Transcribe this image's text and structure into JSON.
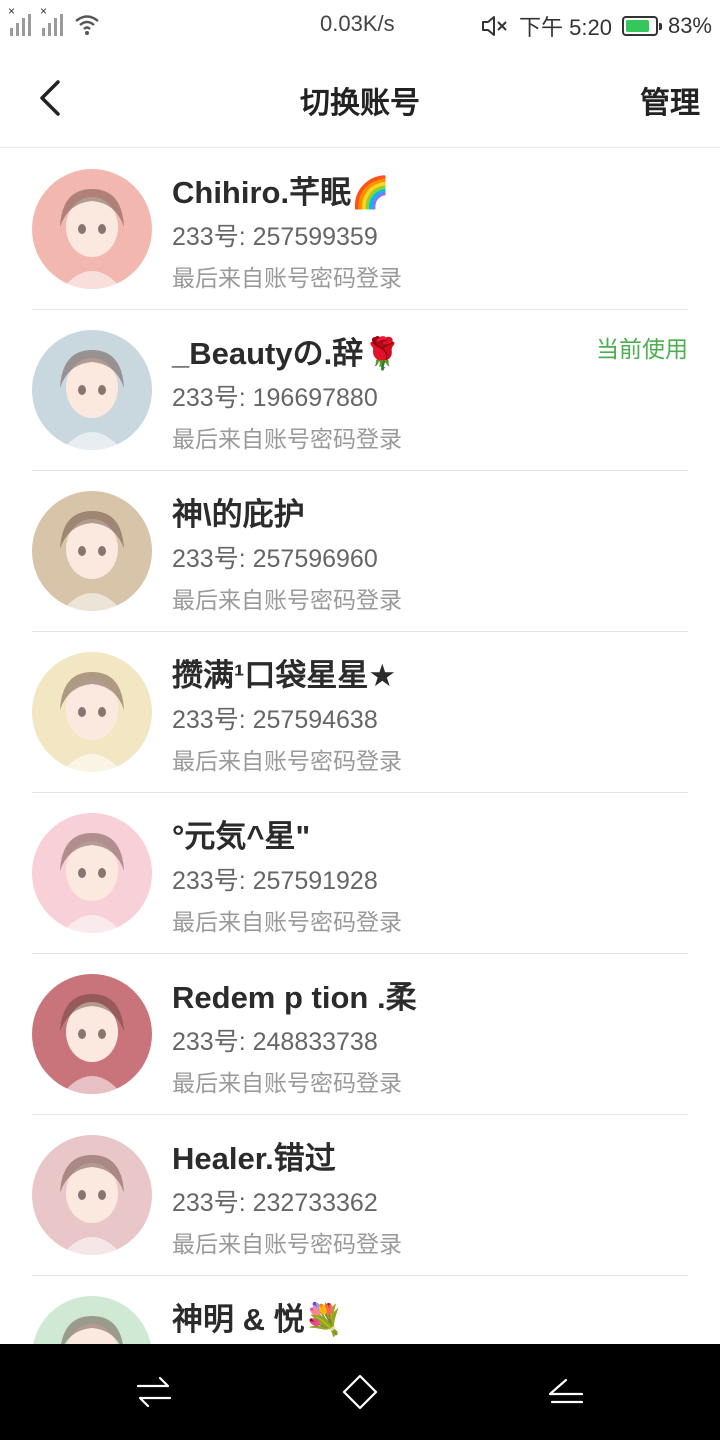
{
  "status_bar": {
    "network_speed": "0.03K/s",
    "time": "下午 5:20",
    "battery_percent": "83%",
    "battery_level": 0.83,
    "icons": [
      "signal-icon-1",
      "signal-icon-2",
      "wifi-icon",
      "mute-icon",
      "battery-icon"
    ]
  },
  "header": {
    "title": "切换账号",
    "manage_label": "管理",
    "back_icon": "chevron-left-icon"
  },
  "accounts": [
    {
      "name": "Chihiro.芊眠",
      "emoji": "🌈",
      "id": "233号: 257599359",
      "login": "最后来自账号密码登录",
      "current": "",
      "avatar_color": "#f2b8b0"
    },
    {
      "name": "_Beautyの.辞",
      "emoji": "🌹",
      "id": "233号: 196697880",
      "login": "最后来自账号密码登录",
      "current": "当前使用",
      "avatar_color": "#c9d7de"
    },
    {
      "name": "神\\的庇护",
      "emoji": "",
      "id": "233号: 257596960",
      "login": "最后来自账号密码登录",
      "current": "",
      "avatar_color": "#d8c4a8"
    },
    {
      "name": "攒满¹口袋星星★",
      "emoji": "",
      "id": "233号: 257594638",
      "login": "最后来自账号密码登录",
      "current": "",
      "avatar_color": "#f3e6c3"
    },
    {
      "name": "°元気^星\"",
      "emoji": "",
      "id": "233号: 257591928",
      "login": "最后来自账号密码登录",
      "current": "",
      "avatar_color": "#f7d0d8"
    },
    {
      "name": "Redem p tion .柔",
      "emoji": "",
      "id": "233号: 248833738",
      "login": "最后来自账号密码登录",
      "current": "",
      "avatar_color": "#c9747a"
    },
    {
      "name": "Healer.错过",
      "emoji": "",
      "id": "233号: 232733362",
      "login": "最后来自账号密码登录",
      "current": "",
      "avatar_color": "#e9c7c9"
    },
    {
      "name": "神明 & 悦",
      "emoji": "💐",
      "id": "",
      "login": "",
      "current": "",
      "avatar_color": "#cfe9d4"
    }
  ],
  "colors": {
    "accent_green": "#4caf50",
    "battery_green": "#34c759",
    "nav_background": "#000000"
  },
  "nav_bar": {
    "icons": [
      "recent-apps-icon",
      "home-icon",
      "back-icon"
    ]
  }
}
